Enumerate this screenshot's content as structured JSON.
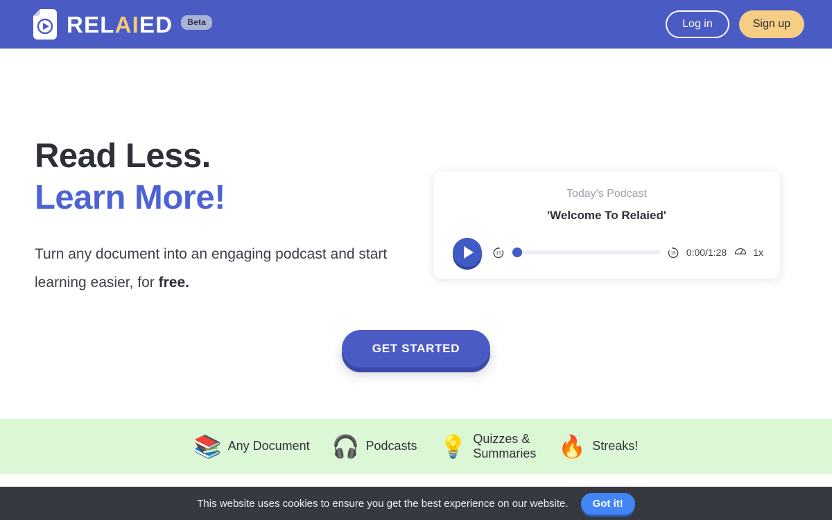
{
  "header": {
    "logo_icon": "document-play-icon",
    "brand_prefix": "REL",
    "brand_accent": "AI",
    "brand_suffix": "ED",
    "beta_label": "Beta",
    "login_label": "Log in",
    "signup_label": "Sign up",
    "bg_color": "#4b5bc4",
    "accent_color": "#f4ca78"
  },
  "hero": {
    "headline_line1": "Read Less.",
    "headline_line2": "Learn More!",
    "headline_line2_color": "#4d63d4",
    "subhead_part1": "Turn any document into an engaging podcast and start learning easier, for ",
    "subhead_bold": "free."
  },
  "player": {
    "eyebrow": "Today's Podcast",
    "title": "'Welcome To Relaied'",
    "play_icon": "play-icon",
    "rewind_icon": "rewind-15-icon",
    "forward_icon": "forward-15-icon",
    "speed_icon": "speedometer-icon",
    "time_label": "0:00/1:28",
    "speed_label": "1x",
    "progress_percent": 0,
    "accent_color": "#3f5bc4"
  },
  "cta": {
    "label": "GET STARTED"
  },
  "features": {
    "bg_color": "#dcf7d6",
    "items": [
      {
        "emoji": "📚",
        "icon_name": "books-emoji",
        "label": "Any Document"
      },
      {
        "emoji": "🎧",
        "icon_name": "headphones-emoji",
        "label": "Podcasts"
      },
      {
        "emoji": "💡",
        "icon_name": "lightbulb-emoji",
        "label": "Quizzes &\nSummaries"
      },
      {
        "emoji": "🔥",
        "icon_name": "fire-emoji",
        "label": "Streaks!"
      }
    ]
  },
  "cookie": {
    "message": "This website uses cookies to ensure you get the best experience on our website.",
    "accept_label": "Got it!",
    "bg_color": "#343a40",
    "button_color": "#4285f4"
  }
}
